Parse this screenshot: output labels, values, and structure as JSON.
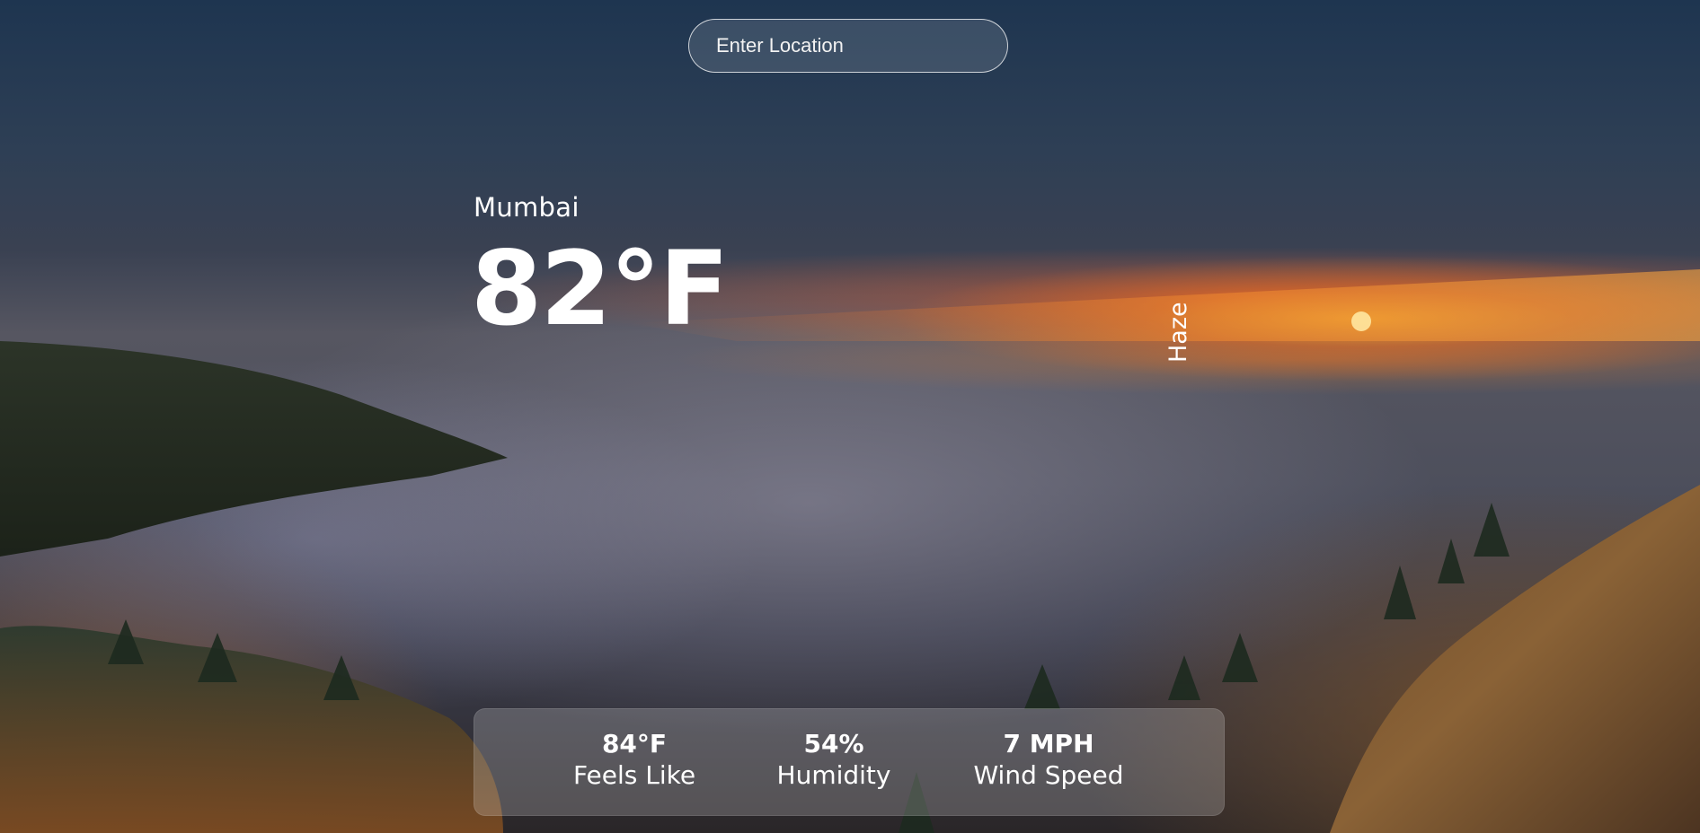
{
  "search": {
    "placeholder": "Enter Location",
    "value": ""
  },
  "weather": {
    "city": "Mumbai",
    "temperature": "82°F",
    "condition": "Haze"
  },
  "stats": [
    {
      "value": "84°F",
      "label": "Feels Like"
    },
    {
      "value": "54%",
      "label": "Humidity"
    },
    {
      "value": "7 MPH",
      "label": "Wind Speed"
    }
  ],
  "colors": {
    "text": "#ffffff",
    "panel": "rgba(255,255,255,0.20)",
    "sky_top": "#1e3550",
    "sunset": "#f0a020"
  }
}
